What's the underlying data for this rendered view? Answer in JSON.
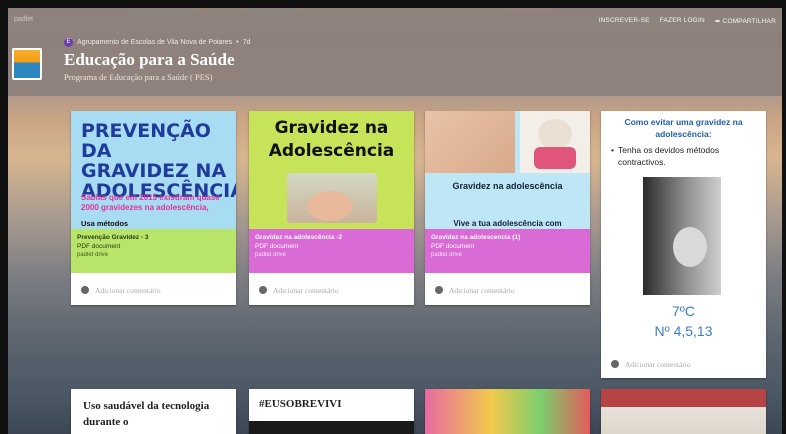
{
  "topbar": {
    "brand": "padlet",
    "nav": [
      "INSCREVER-SE",
      "FAZER LOGIN",
      "COMPARTILHAR"
    ]
  },
  "header": {
    "author_initial": "E",
    "author": "Agrupamento de Escolas de Vila Nova de Poiares",
    "age": "7d",
    "title": "Educação para a Saúde",
    "subtitle": "Programa de Educação para a Saúde ( PES)"
  },
  "comment_placeholder": "Adicionar comentário",
  "cards": [
    {
      "poster_lines": [
        "PREVENÇÃO DA",
        "GRAVIDEZ NA",
        "ADOLESCÊNCIA"
      ],
      "poster_text": "Sabias que em 2015 existiram quase 2000 gravidezes na adolescência,",
      "poster_sub": "Usa métodos",
      "title": "Prevenção Gravidez - 3",
      "type": "PDF document",
      "source": "padlet drive",
      "meta_color": "#b9e46a"
    },
    {
      "poster_lines": [
        "Gravidez na",
        "Adolescência"
      ],
      "title": "Gravidez na adolescência -2",
      "type": "PDF document",
      "source": "padlet drive",
      "meta_color": "#d96ad6"
    },
    {
      "poster_title": "Gravidez na adolescência",
      "poster_foot": "Vive a tua adolescência com",
      "title": "Gravidez na adolescencia (1)",
      "type": "PDF document",
      "source": "padlet drive",
      "meta_color": "#d96ad6"
    },
    {
      "heading": "Como evitar uma gravidez na adolescência:",
      "bullet": "Tenha os devidos métodos contractivos.",
      "line1": "7ºC",
      "line2": "Nº 4,5,13"
    }
  ],
  "bottom_cards": [
    {
      "text": "Uso saudável da tecnologia durante o"
    },
    {
      "text": "#EUSOBREVIVI"
    }
  ]
}
